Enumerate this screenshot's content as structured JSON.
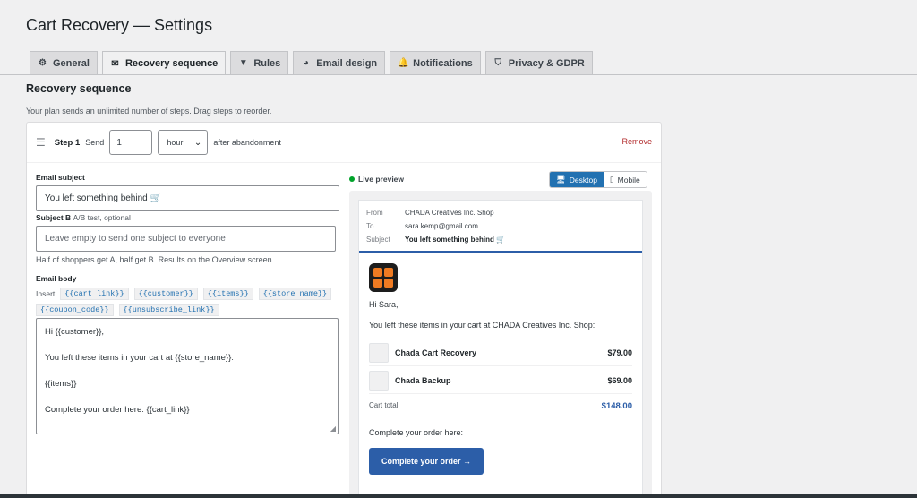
{
  "page": {
    "title": "Cart Recovery — Settings"
  },
  "tabs": [
    {
      "label": "General",
      "icon": "gear-icon",
      "glyph": "⚙",
      "active": false
    },
    {
      "label": "Recovery sequence",
      "icon": "envelope-icon",
      "glyph": "✉",
      "active": true
    },
    {
      "label": "Rules",
      "icon": "filter-icon",
      "glyph": "▼",
      "active": false
    },
    {
      "label": "Email design",
      "icon": "palette-icon",
      "glyph": "◕",
      "active": false
    },
    {
      "label": "Notifications",
      "icon": "bell-icon",
      "glyph": "🔔",
      "active": false
    },
    {
      "label": "Privacy & GDPR",
      "icon": "shield-icon",
      "glyph": "⛉",
      "active": false
    }
  ],
  "section": {
    "title": "Recovery sequence",
    "plan_note": "Your plan sends an unlimited number of steps. Drag steps to reorder."
  },
  "step": {
    "label": "Step 1",
    "send_label": "Send",
    "send_value": "1",
    "unit_value": "hour",
    "after_text": "after abandonment",
    "remove_label": "Remove"
  },
  "form": {
    "subject_label": "Email subject",
    "subject_value": "You left something behind 🛒",
    "subject_b_label": "Subject B",
    "subject_b_opt": "A/B test, optional",
    "subject_b_placeholder": "Leave empty to send one subject to everyone",
    "subject_b_helper": "Half of shoppers get A, half get B. Results on the Overview screen.",
    "body_label": "Email body",
    "insert_label": "Insert",
    "tokens": [
      "{{cart_link}}",
      "{{customer}}",
      "{{items}}",
      "{{store_name}}",
      "{{coupon_code}}",
      "{{unsubscribe_link}}"
    ],
    "body_lines": [
      "Hi {{customer}},",
      "You left these items in your cart at {{store_name}}:",
      "{{items}}",
      "Complete your order here: {{cart_link}}"
    ]
  },
  "preview": {
    "live_label": "Live preview",
    "desktop_label": "Desktop",
    "mobile_label": "Mobile",
    "from_key": "From",
    "from_value": "CHADA Creatives Inc. Shop",
    "to_key": "To",
    "to_value": "sara.kemp@gmail.com",
    "subject_key": "Subject",
    "subject_value": "You left something behind 🛒",
    "greeting": "Hi Sara,",
    "intro": "You left these items in your cart at CHADA Creatives Inc. Shop:",
    "items": [
      {
        "name": "Chada Cart Recovery",
        "price": "$79.00"
      },
      {
        "name": "Chada Backup",
        "price": "$69.00"
      }
    ],
    "total_label": "Cart total",
    "total_value": "$148.00",
    "complete_text": "Complete your order here:",
    "cta_label": "Complete your order →"
  },
  "colors": {
    "accent": "#2271b1",
    "brand_blue": "#2c5ea8",
    "remove_red": "#b32d2e",
    "live_green": "#00a32a",
    "logo_orange": "#f07b22"
  }
}
